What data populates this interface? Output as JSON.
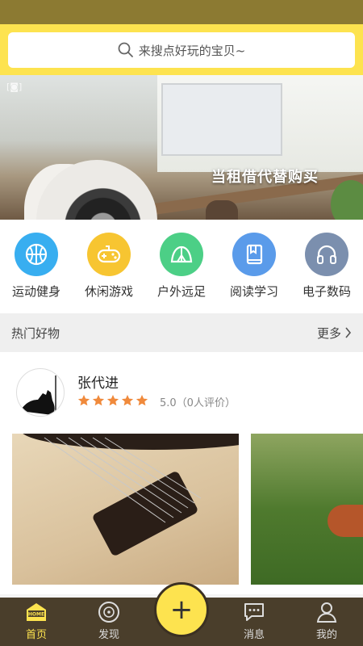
{
  "search": {
    "placeholder": "来搜点好玩的宝贝~"
  },
  "banner": {
    "caption": "当租借代替购买"
  },
  "categories": [
    {
      "label": "运动健身",
      "icon": "basketball-icon",
      "color": "#38aef0"
    },
    {
      "label": "休闲游戏",
      "icon": "gamepad-icon",
      "color": "#f7c531"
    },
    {
      "label": "户外远足",
      "icon": "tent-icon",
      "color": "#4ccf86"
    },
    {
      "label": "阅读学习",
      "icon": "book-icon",
      "color": "#5a9bea"
    },
    {
      "label": "电子数码",
      "icon": "headphones-icon",
      "color": "#7b8fae"
    }
  ],
  "section": {
    "title": "热门好物",
    "more": "更多"
  },
  "card": {
    "user_name": "张代进",
    "rating": 5,
    "rating_text": "5.0（0人评价）"
  },
  "tabs": [
    {
      "label": "首页",
      "icon": "home-icon",
      "active": true,
      "badge": "HOME"
    },
    {
      "label": "发现",
      "icon": "discover-icon",
      "active": false
    },
    {
      "label": "消息",
      "icon": "message-icon",
      "active": false
    },
    {
      "label": "我的",
      "icon": "user-icon",
      "active": false
    }
  ],
  "fab": {
    "label": "+"
  },
  "colors": {
    "accent": "#fde34f",
    "tabbar": "#4a3e2b",
    "star": "#f08a3c"
  }
}
